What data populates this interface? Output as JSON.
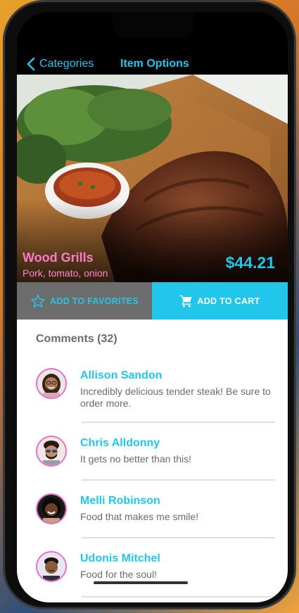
{
  "nav": {
    "back_label": "Categories",
    "title": "Item Options"
  },
  "item": {
    "name": "Wood Grills",
    "ingredients": "Pork, tomato, onion",
    "price": "$44.21"
  },
  "actions": {
    "favorites_label": "ADD TO FAVORITES",
    "cart_label": "ADD TO CART"
  },
  "comments": {
    "header": "Comments (32)",
    "items": [
      {
        "name": "Allison Sandon",
        "text": "Incredibly delicious tender steak! Be sure to order more."
      },
      {
        "name": "Chris Alldonny",
        "text": "It gets no better than this!"
      },
      {
        "name": "Melli Robinson",
        "text": "Food that makes me smile!"
      },
      {
        "name": "Udonis Mitchel",
        "text": "Food for the soul!"
      }
    ]
  },
  "colors": {
    "accent": "#22c6ea",
    "pink": "#ff7ac8",
    "favorites_bg": "#6d6d6d"
  }
}
